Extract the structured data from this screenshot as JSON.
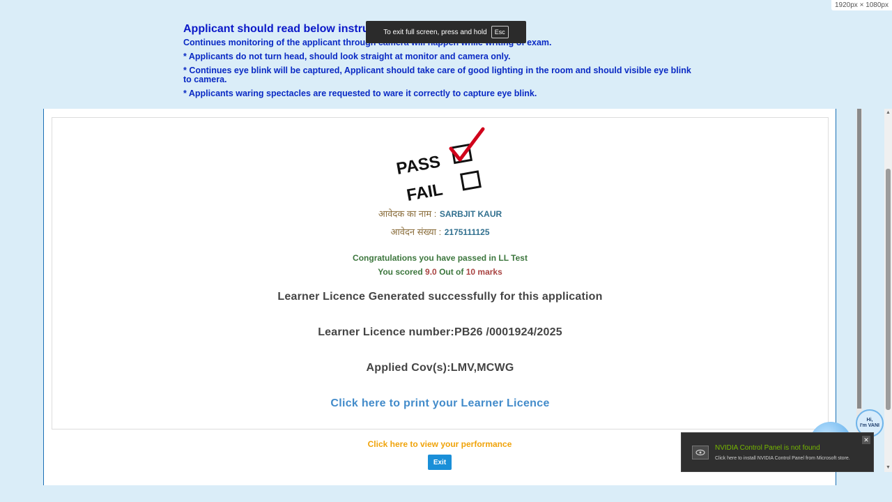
{
  "resolution_badge": "1920px × 1080px",
  "instructions": {
    "title": "Applicant should read below instru",
    "lines": [
      "Continues monitoring of the applicant through camera will happen while writing of exam.",
      "* Applicants do not turn head, should look straight at monitor and camera only.",
      "* Continues eye blink will be captured, Applicant should take care of good lighting in the room and should visible eye blink to camera.",
      "* Applicants waring spectacles are requested to ware it correctly to capture eye blink."
    ]
  },
  "fullscreen_toast": {
    "text": "To exit full screen, press and hold",
    "key": "Esc"
  },
  "result": {
    "pass_label": "PASS",
    "fail_label": "FAIL",
    "name_label": "आवेदक का नाम :",
    "name_value": "SARBJIT KAUR",
    "app_label": "आवेदन संख्या :",
    "app_value": "2175111125",
    "congrats_text": "Congratulations you have passed in LL Test",
    "score_prefix": "You scored",
    "score_value": "9.0",
    "score_mid": "Out of",
    "score_total": "10 marks",
    "generated_text": "Learner Licence Generated successfully for this application",
    "licence_number_text": "Learner Licence number:PB26 /0001924/2025",
    "cov_text": "Applied Cov(s):LMV,MCWG",
    "print_link": "Click here to print your Learner Licence",
    "performance_link": "Click here to view your performance",
    "exit_button": "Exit"
  },
  "vani": {
    "bubble_line1": "Hi,",
    "bubble_line2": "I'm VANI"
  },
  "nvidia_toast": {
    "title": "NVIDIA Control Panel is not found",
    "subtitle": "Click here to install NVIDIA Control Panel from Microsoft store.",
    "close": "✕"
  },
  "colors": {
    "background": "#daedf8",
    "instruction_blue": "#0a2ac4",
    "pass_green": "#3c763d",
    "link_blue": "#428bca",
    "perf_orange": "#f0a30a",
    "tick_red": "#d0021b"
  }
}
